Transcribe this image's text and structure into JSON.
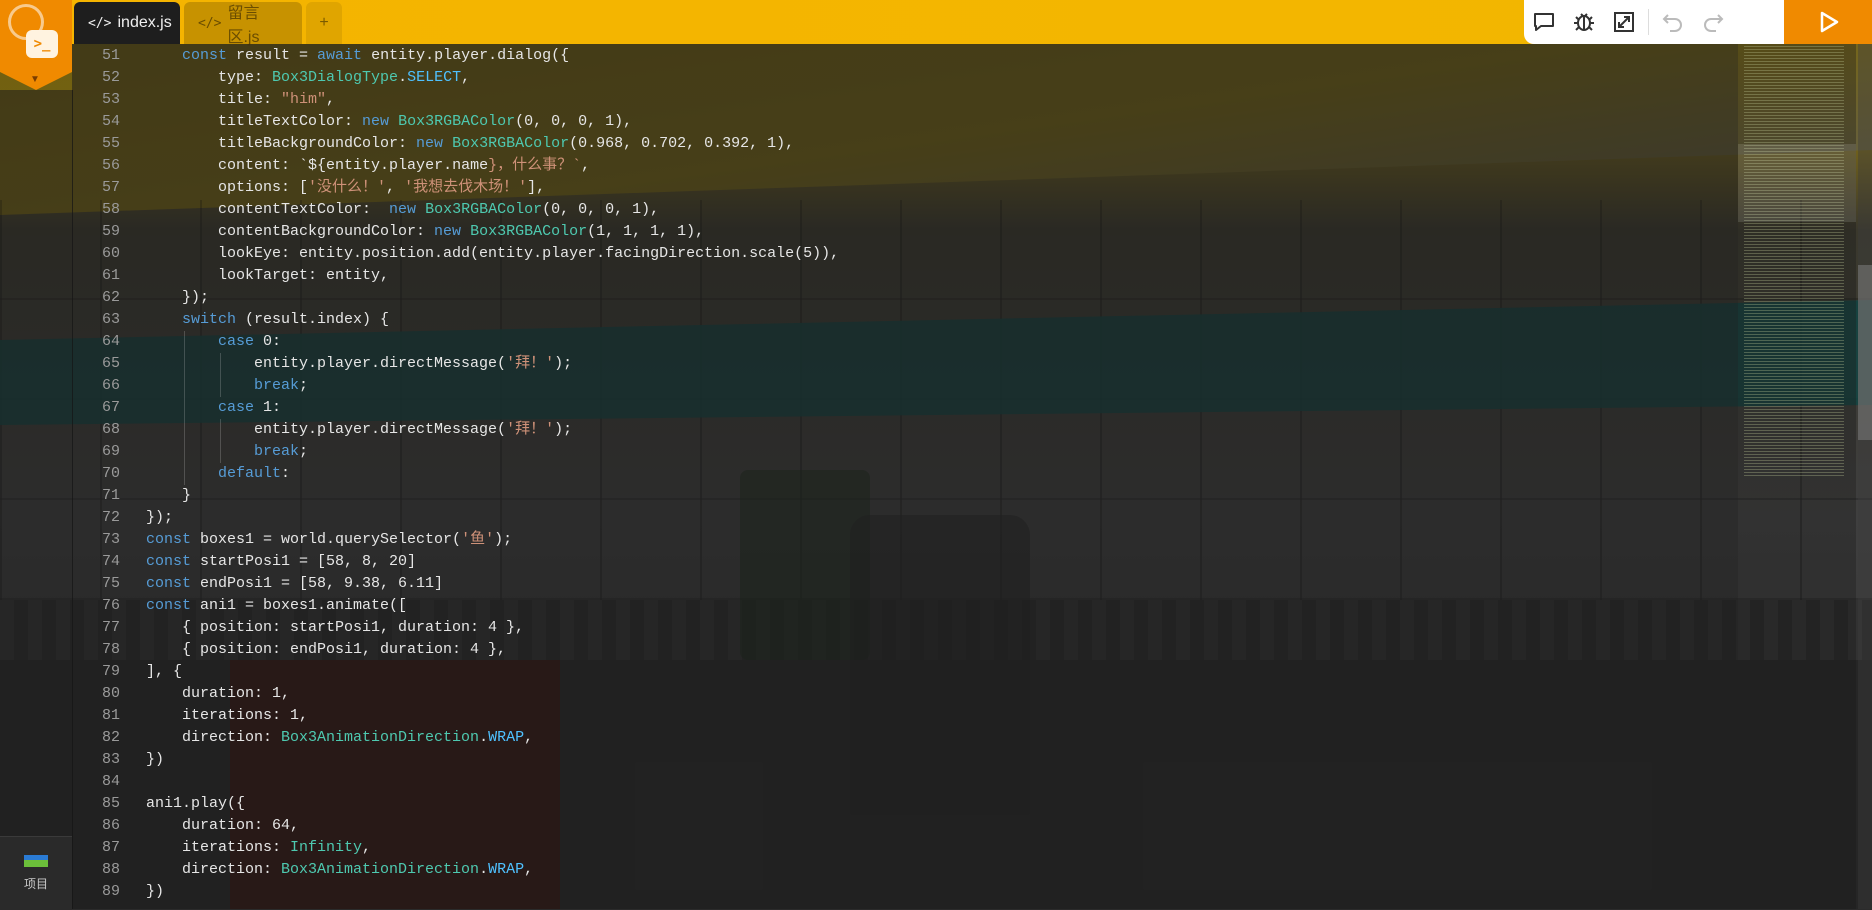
{
  "tabs": [
    {
      "label": "index.js",
      "icon": "code-icon",
      "active": true
    },
    {
      "label": "留言区.js",
      "icon": "code-icon",
      "active": false
    }
  ],
  "add_tab_label": "+",
  "toolbar": {
    "buttons": [
      "comment-icon",
      "bug-icon",
      "expand-icon",
      "undo-icon",
      "redo-icon"
    ],
    "run_icon": "play-icon"
  },
  "sidebar": {
    "project_label": "项目"
  },
  "code_lines": [
    {
      "n": "51",
      "tokens": [
        [
          "    ",
          ""
        ],
        [
          "const",
          "#569cd6"
        ],
        [
          " result = ",
          ""
        ],
        [
          "await",
          "#569cd6"
        ],
        [
          " entity.player.dialog({",
          ""
        ]
      ]
    },
    {
      "n": "52",
      "tokens": [
        [
          "        type: ",
          ""
        ],
        [
          "Box3DialogType",
          "#4ec9b0"
        ],
        [
          ".",
          ""
        ],
        [
          "SELECT",
          "#4fc1ff"
        ],
        [
          ",",
          ""
        ]
      ]
    },
    {
      "n": "53",
      "tokens": [
        [
          "        title: ",
          ""
        ],
        [
          "\"him\"",
          "#ce9178"
        ],
        [
          ",",
          ""
        ]
      ]
    },
    {
      "n": "54",
      "tokens": [
        [
          "        titleTextColor: ",
          ""
        ],
        [
          "new",
          "#569cd6"
        ],
        [
          " ",
          ""
        ],
        [
          "Box3RGBAColor",
          "#4ec9b0"
        ],
        [
          "(0, 0, 0, 1),",
          ""
        ]
      ]
    },
    {
      "n": "55",
      "tokens": [
        [
          "        titleBackgroundColor: ",
          ""
        ],
        [
          "new",
          "#569cd6"
        ],
        [
          " ",
          ""
        ],
        [
          "Box3RGBAColor",
          "#4ec9b0"
        ],
        [
          "(0.968, 0.702, 0.392, 1),",
          ""
        ]
      ]
    },
    {
      "n": "56",
      "tokens": [
        [
          "        content: ",
          ""
        ],
        [
          "`${",
          ""
        ],
        [
          "entity.player.name",
          ""
        ],
        [
          "}，什么事？`",
          "#ce9178"
        ],
        [
          ",",
          ""
        ]
      ]
    },
    {
      "n": "57",
      "tokens": [
        [
          "        options: [",
          ""
        ],
        [
          "'没什么！'",
          "#ce9178"
        ],
        [
          ", ",
          ""
        ],
        [
          "'我想去伐木场！'",
          "#ce9178"
        ],
        [
          "],",
          ""
        ]
      ]
    },
    {
      "n": "58",
      "tokens": [
        [
          "        contentTextColor:  ",
          ""
        ],
        [
          "new",
          "#569cd6"
        ],
        [
          " ",
          ""
        ],
        [
          "Box3RGBAColor",
          "#4ec9b0"
        ],
        [
          "(0, 0, 0, 1),",
          ""
        ]
      ]
    },
    {
      "n": "59",
      "tokens": [
        [
          "        contentBackgroundColor: ",
          ""
        ],
        [
          "new",
          "#569cd6"
        ],
        [
          " ",
          ""
        ],
        [
          "Box3RGBAColor",
          "#4ec9b0"
        ],
        [
          "(1, 1, 1, 1),",
          ""
        ]
      ]
    },
    {
      "n": "60",
      "tokens": [
        [
          "        lookEye: entity.position.add(entity.player.facingDirection.scale(5)),",
          ""
        ]
      ]
    },
    {
      "n": "61",
      "tokens": [
        [
          "        lookTarget: entity,",
          ""
        ]
      ]
    },
    {
      "n": "62",
      "tokens": [
        [
          "    });",
          ""
        ]
      ]
    },
    {
      "n": "63",
      "tokens": [
        [
          "    ",
          ""
        ],
        [
          "switch",
          "#569cd6"
        ],
        [
          " (result.index) {",
          ""
        ]
      ]
    },
    {
      "n": "64",
      "tokens": [
        [
          "        ",
          ""
        ],
        [
          "case",
          "#569cd6"
        ],
        [
          " 0:",
          ""
        ]
      ]
    },
    {
      "n": "65",
      "tokens": [
        [
          "            entity.player.directMessage(",
          ""
        ],
        [
          "'拜！'",
          "#ce9178"
        ],
        [
          ");",
          ""
        ]
      ]
    },
    {
      "n": "66",
      "tokens": [
        [
          "            ",
          ""
        ],
        [
          "break",
          "#569cd6"
        ],
        [
          ";",
          ""
        ]
      ]
    },
    {
      "n": "67",
      "tokens": [
        [
          "        ",
          ""
        ],
        [
          "case",
          "#569cd6"
        ],
        [
          " 1:",
          ""
        ]
      ]
    },
    {
      "n": "68",
      "tokens": [
        [
          "            entity.player.directMessage(",
          ""
        ],
        [
          "'拜！'",
          "#ce9178"
        ],
        [
          ");",
          ""
        ]
      ]
    },
    {
      "n": "69",
      "tokens": [
        [
          "            ",
          ""
        ],
        [
          "break",
          "#569cd6"
        ],
        [
          ";",
          ""
        ]
      ]
    },
    {
      "n": "70",
      "tokens": [
        [
          "        ",
          ""
        ],
        [
          "default",
          "#569cd6"
        ],
        [
          ":",
          ""
        ]
      ]
    },
    {
      "n": "71",
      "tokens": [
        [
          "    }",
          ""
        ]
      ]
    },
    {
      "n": "72",
      "tokens": [
        [
          "});",
          ""
        ]
      ]
    },
    {
      "n": "73",
      "tokens": [
        [
          "const",
          "#569cd6"
        ],
        [
          " boxes1 = world.querySelector(",
          ""
        ],
        [
          "'鱼'",
          "#ce9178"
        ],
        [
          ");",
          ""
        ]
      ]
    },
    {
      "n": "74",
      "tokens": [
        [
          "const",
          "#569cd6"
        ],
        [
          " startPosi1 = [58, 8, 20]",
          ""
        ]
      ]
    },
    {
      "n": "75",
      "tokens": [
        [
          "const",
          "#569cd6"
        ],
        [
          " endPosi1 = [58, 9.38, 6.11]",
          ""
        ]
      ]
    },
    {
      "n": "76",
      "tokens": [
        [
          "const",
          "#569cd6"
        ],
        [
          " ani1 = boxes1.animate([",
          ""
        ]
      ]
    },
    {
      "n": "77",
      "tokens": [
        [
          "    { position: startPosi1, duration: 4 },",
          ""
        ]
      ]
    },
    {
      "n": "78",
      "tokens": [
        [
          "    { position: endPosi1, duration: 4 },",
          ""
        ]
      ]
    },
    {
      "n": "79",
      "tokens": [
        [
          "], {",
          ""
        ]
      ]
    },
    {
      "n": "80",
      "tokens": [
        [
          "    duration: 1,",
          ""
        ]
      ]
    },
    {
      "n": "81",
      "tokens": [
        [
          "    iterations: 1,",
          ""
        ]
      ]
    },
    {
      "n": "82",
      "tokens": [
        [
          "    direction: ",
          ""
        ],
        [
          "Box3AnimationDirection",
          "#4ec9b0"
        ],
        [
          ".",
          ""
        ],
        [
          "WRAP",
          "#4fc1ff"
        ],
        [
          ",",
          ""
        ]
      ]
    },
    {
      "n": "83",
      "tokens": [
        [
          "})",
          ""
        ]
      ]
    },
    {
      "n": "84",
      "tokens": [
        [
          "",
          ""
        ]
      ]
    },
    {
      "n": "85",
      "tokens": [
        [
          "ani1.play({",
          ""
        ]
      ]
    },
    {
      "n": "86",
      "tokens": [
        [
          "    duration: 64,",
          ""
        ]
      ]
    },
    {
      "n": "87",
      "tokens": [
        [
          "    iterations: ",
          ""
        ],
        [
          "Infinity",
          "#4ec9b0"
        ],
        [
          ",",
          ""
        ]
      ]
    },
    {
      "n": "88",
      "tokens": [
        [
          "    direction: ",
          ""
        ],
        [
          "Box3AnimationDirection",
          "#4ec9b0"
        ],
        [
          ".",
          ""
        ],
        [
          "WRAP",
          "#4fc1ff"
        ],
        [
          ",",
          ""
        ]
      ]
    },
    {
      "n": "89",
      "tokens": [
        [
          "})",
          ""
        ]
      ]
    }
  ]
}
